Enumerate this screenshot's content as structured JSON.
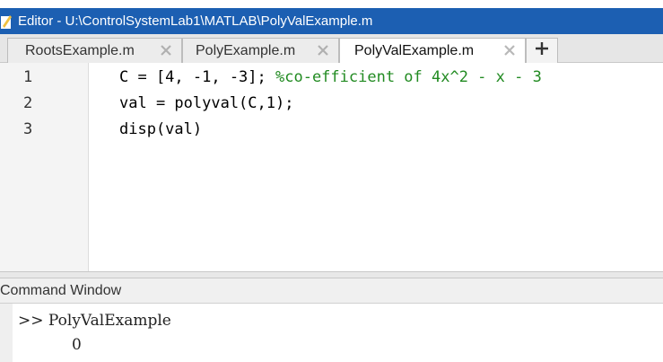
{
  "window": {
    "title": "Editor - U:\\ControlSystemLab1\\MATLAB\\PolyValExample.m"
  },
  "tabs": [
    {
      "label": "RootsExample.m",
      "active": false
    },
    {
      "label": "PolyExample.m",
      "active": false
    },
    {
      "label": "PolyValExample.m",
      "active": true
    }
  ],
  "add_tab_icon": "plus-icon",
  "editor": {
    "line_numbers": [
      "1",
      "2",
      "3"
    ],
    "lines": [
      {
        "code": "C = [4, -1, -3]; ",
        "comment": "%co-efficient of 4x^2 - x - 3"
      },
      {
        "code": "val = polyval(C,1);",
        "comment": ""
      },
      {
        "code": "disp(val)",
        "comment": ""
      }
    ]
  },
  "command_window": {
    "title": "Command Window",
    "prompt_line": ">> PolyValExample",
    "output_line": "0"
  },
  "colors": {
    "titlebar": "#1c5fb2",
    "comment": "#228b22"
  }
}
